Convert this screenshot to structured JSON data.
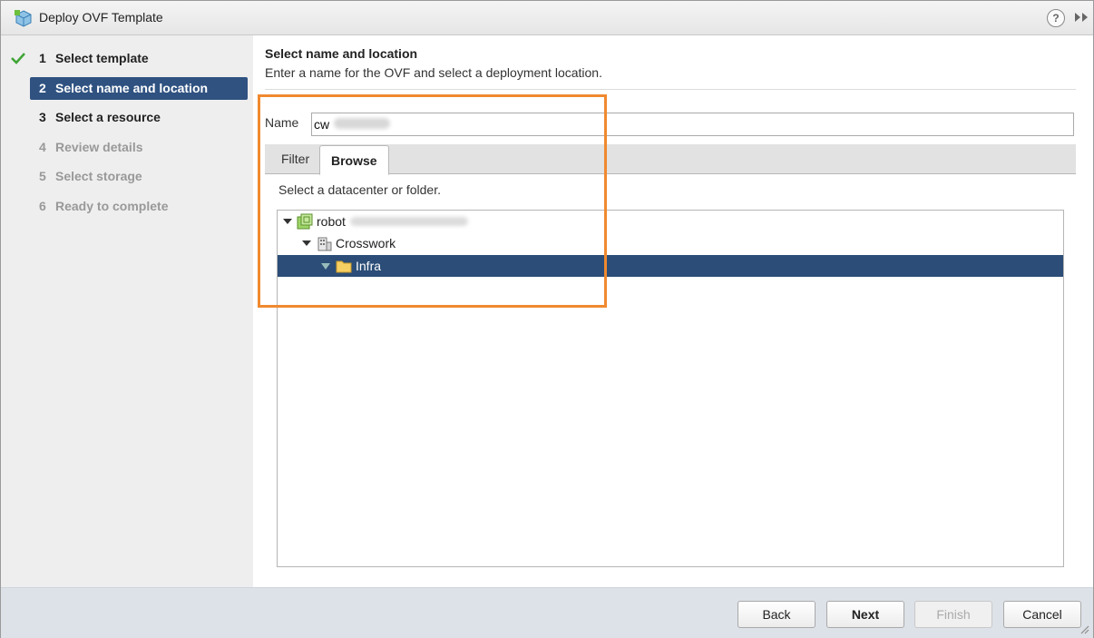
{
  "window": {
    "title": "Deploy OVF Template",
    "help_symbol": "?"
  },
  "steps": [
    {
      "num": "1",
      "label": "Select template",
      "state": "done"
    },
    {
      "num": "2",
      "label": "Select name and location",
      "state": "active"
    },
    {
      "num": "3",
      "label": "Select a resource",
      "state": "upcoming"
    },
    {
      "num": "4",
      "label": "Review details",
      "state": "disabled"
    },
    {
      "num": "5",
      "label": "Select storage",
      "state": "disabled"
    },
    {
      "num": "6",
      "label": "Ready to complete",
      "state": "disabled"
    }
  ],
  "header": {
    "title": "Select name and location",
    "subtitle": "Enter a name for the OVF and select a deployment location."
  },
  "name_field": {
    "label": "Name",
    "value": "cw"
  },
  "tabs": [
    {
      "label": "Filter",
      "selected": false
    },
    {
      "label": "Browse",
      "selected": true
    }
  ],
  "browse": {
    "instruction": "Select a datacenter or folder.",
    "tree": [
      {
        "label": "robot",
        "icon": "vcenter-icon",
        "expanded": true,
        "selected": false
      },
      {
        "label": "Crosswork",
        "icon": "datacenter-icon",
        "expanded": true,
        "selected": false
      },
      {
        "label": "Infra",
        "icon": "folder-icon",
        "expanded": false,
        "selected": true
      }
    ]
  },
  "footer": {
    "back": "Back",
    "next": "Next",
    "finish": "Finish",
    "cancel": "Cancel"
  },
  "colors": {
    "active_step_bg": "#2f5281",
    "selected_node_bg": "#2b4d77",
    "highlight_border": "#f0892f",
    "check_green": "#3fa535"
  }
}
